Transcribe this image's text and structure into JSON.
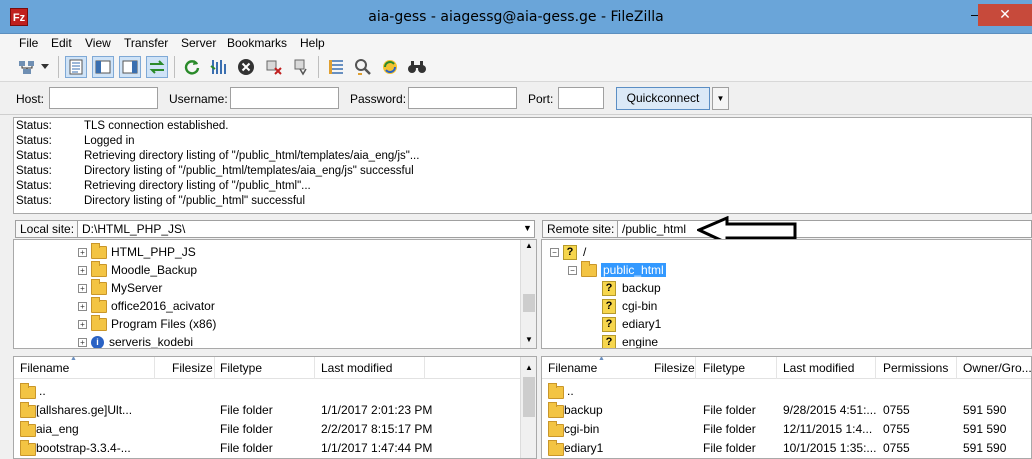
{
  "window": {
    "title": "aia-gess - aiagessg@aia-gess.ge - FileZilla",
    "app_icon": "Fz",
    "minimize": "—",
    "close": "✕"
  },
  "menu": [
    "File",
    "Edit",
    "View",
    "Transfer",
    "Server",
    "Bookmarks",
    "Help"
  ],
  "toolbar": {
    "icons": [
      "site-manager-icon",
      "dropdown-arrow-icon",
      "toggle-log-icon",
      "toggle-local-tree-icon",
      "toggle-remote-tree-icon",
      "toggle-queue-icon",
      "refresh-icon",
      "process-queue-icon",
      "cancel-icon",
      "disconnect-icon",
      "reconnect-icon",
      "directory-filter-icon",
      "sync-browsing-icon",
      "compare-icon",
      "search-icon"
    ]
  },
  "quickconnect": {
    "host_label": "Host:",
    "host_value": "",
    "username_label": "Username:",
    "username_value": "",
    "password_label": "Password:",
    "password_value": "",
    "port_label": "Port:",
    "port_value": "",
    "button": "Quickconnect",
    "dropdown": "▼"
  },
  "log": [
    {
      "k": "Status:",
      "v": "TLS connection established."
    },
    {
      "k": "Status:",
      "v": "Logged in"
    },
    {
      "k": "Status:",
      "v": "Retrieving directory listing of \"/public_html/templates/aia_eng/js\"..."
    },
    {
      "k": "Status:",
      "v": "Directory listing of \"/public_html/templates/aia_eng/js\" successful"
    },
    {
      "k": "Status:",
      "v": "Retrieving directory listing of \"/public_html\"..."
    },
    {
      "k": "Status:",
      "v": "Directory listing of \"/public_html\" successful"
    }
  ],
  "local": {
    "site_label": "Local site:",
    "site_path": "D:\\HTML_PHP_JS\\",
    "tree": [
      {
        "name": "HTML_PHP_JS",
        "icon": "folder"
      },
      {
        "name": "Moodle_Backup",
        "icon": "folder"
      },
      {
        "name": "MyServer",
        "icon": "folder"
      },
      {
        "name": "office2016_acivator",
        "icon": "folder"
      },
      {
        "name": "Program Files (x86)",
        "icon": "folder"
      },
      {
        "name": "serveris_kodebi",
        "icon": "info"
      }
    ],
    "columns": [
      "Filename",
      "Filesize",
      "Filetype",
      "Last modified"
    ],
    "files": [
      {
        "name": "..",
        "size": "",
        "type": "",
        "modified": ""
      },
      {
        "name": "[allshares.ge]Ult...",
        "size": "",
        "type": "File folder",
        "modified": "1/1/2017 2:01:23 PM"
      },
      {
        "name": "aia_eng",
        "size": "",
        "type": "File folder",
        "modified": "2/2/2017 8:15:17 PM"
      },
      {
        "name": "bootstrap-3.3.4-...",
        "size": "",
        "type": "File folder",
        "modified": "1/1/2017 1:47:44 PM"
      }
    ]
  },
  "remote": {
    "site_label": "Remote site:",
    "site_path": "/public_html",
    "tree": [
      {
        "name": "/",
        "icon": "unknown",
        "level": 0,
        "expander": "−"
      },
      {
        "name": "public_html",
        "icon": "folder",
        "level": 1,
        "expander": "−",
        "selected": true
      },
      {
        "name": "backup",
        "icon": "unknown",
        "level": 2
      },
      {
        "name": "cgi-bin",
        "icon": "unknown",
        "level": 2
      },
      {
        "name": "ediary1",
        "icon": "unknown",
        "level": 2
      },
      {
        "name": "engine",
        "icon": "unknown",
        "level": 2
      }
    ],
    "columns": [
      "Filename",
      "Filesize",
      "Filetype",
      "Last modified",
      "Permissions",
      "Owner/Gro..."
    ],
    "files": [
      {
        "name": "..",
        "size": "",
        "type": "",
        "modified": "",
        "perms": "",
        "owner": ""
      },
      {
        "name": "backup",
        "size": "",
        "type": "File folder",
        "modified": "9/28/2015 4:51:...",
        "perms": "0755",
        "owner": "591 590"
      },
      {
        "name": "cgi-bin",
        "size": "",
        "type": "File folder",
        "modified": "12/11/2015 1:4...",
        "perms": "0755",
        "owner": "591 590"
      },
      {
        "name": "ediary1",
        "size": "",
        "type": "File folder",
        "modified": "10/1/2015 1:35:...",
        "perms": "0755",
        "owner": "591 590"
      }
    ]
  },
  "colors": {
    "titlebar": "#6aa5d9",
    "close": "#c74a3b",
    "selection": "#3399ff",
    "folder": "#f3c443"
  }
}
